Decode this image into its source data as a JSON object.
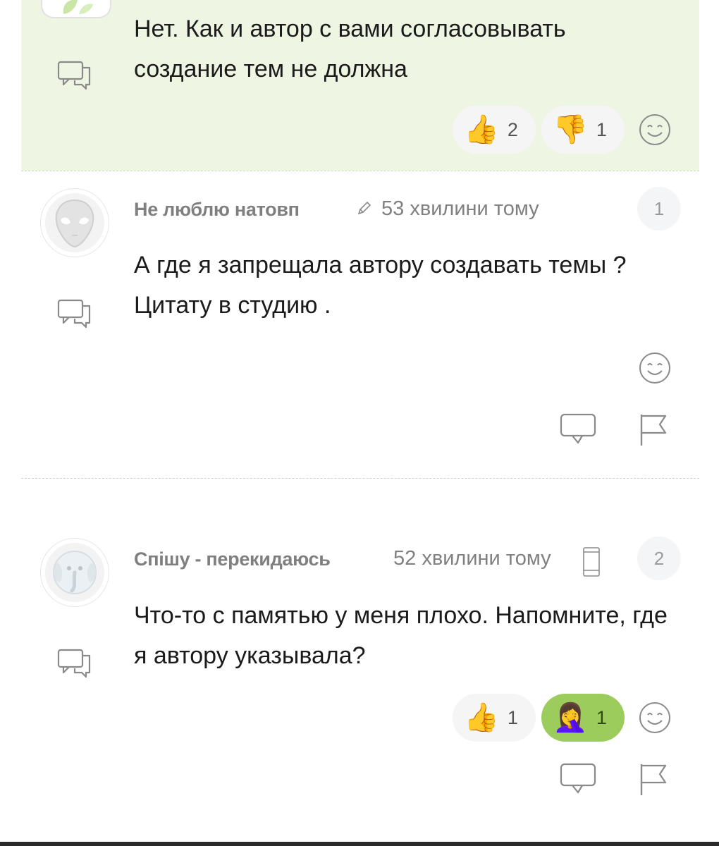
{
  "comments": [
    {
      "text": "Нет. Как и автор с вами согласовывать создание тем не должна",
      "reactions": [
        {
          "emoji": "👍",
          "count": "2",
          "active": false
        },
        {
          "emoji": "👎",
          "count": "1",
          "active": false
        }
      ]
    },
    {
      "author": "Не люблю натовп",
      "time": "53 хвилини тому",
      "number": "1",
      "text": "А где я запрещала автору создавать темы ? Цитату в студию ."
    },
    {
      "author": "Спішу - перекидаюсь",
      "time": "52 хвилини тому",
      "number": "2",
      "text": "Что-то с памятью у меня плохо. Напомните, где я автору указывала?",
      "reactions": [
        {
          "emoji": "👍",
          "count": "1",
          "active": false
        },
        {
          "emoji": "🤦‍♀️",
          "count": "1",
          "active": true
        }
      ]
    }
  ],
  "icons": {
    "reply": "reply-bubble-icon",
    "edit": "pencil-icon",
    "device": "mobile-phone-icon",
    "react": "smiley-icon",
    "comment": "comment-icon",
    "report": "flag-icon"
  },
  "colors": {
    "highlight_bg": "#eef6e3",
    "active_reaction": "#9ccd5c",
    "author": "#7f7f7f"
  }
}
